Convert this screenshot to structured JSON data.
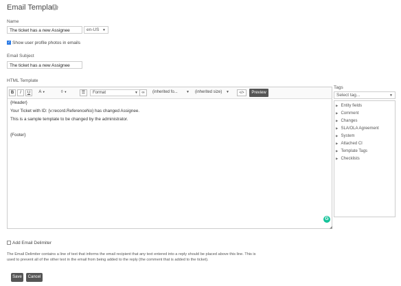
{
  "page": {
    "title": "Email Template",
    "info_glyph": "i"
  },
  "name": {
    "label": "Name",
    "value": "The ticket has a new Assignee",
    "locale": "en-US"
  },
  "profile_photos": {
    "label": "Show user profile photos in emails",
    "checked": true
  },
  "subject": {
    "label": "Email Subject",
    "value": "The ticket has a new Assignee"
  },
  "html_template": {
    "label": "HTML Template",
    "toolbar": {
      "bold": "B",
      "italic": "I",
      "underline": "U",
      "font_color": "A",
      "format": "Format",
      "font": "(inherited fo...",
      "size": "(inherited size)",
      "source": "</>",
      "preview": "Preview"
    },
    "body_lines": [
      "{Header}",
      "Your Ticket with ID: {v:record.ReferenceNo} has changed Assignee.",
      "This is a sample template to be changed by the administrator.",
      "{Footer}"
    ],
    "grammarly_glyph": "G"
  },
  "tags": {
    "label": "Tags",
    "placeholder": "Select tag...",
    "items": [
      "Entity fields",
      "Comment",
      "Changes",
      "SLA/OLA Agreement",
      "System",
      "Attached CI",
      "Template Tags",
      "Checklists"
    ]
  },
  "delimiter": {
    "label": "Add Email Delimiter",
    "checked": false,
    "description_1": "The Email Delimiter contains a line of text that informs the email recipient that any text entered into a reply should be placed above this line. This is",
    "description_2": "used to prevent all of the other text in the email from being added to the reply (the comment that is added to the ticket)."
  },
  "actions": {
    "save": "Save",
    "cancel": "Cancel"
  },
  "colors": {
    "dark_button": "#555555",
    "checkbox": "#2c7be5",
    "grammarly": "#15c39a"
  }
}
